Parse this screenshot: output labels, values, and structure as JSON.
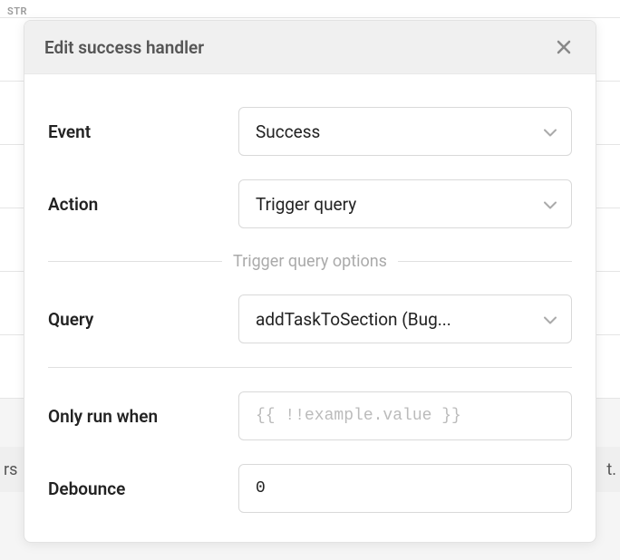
{
  "modal": {
    "title": "Edit success handler",
    "fields": {
      "event": {
        "label": "Event",
        "value": "Success"
      },
      "action": {
        "label": "Action",
        "value": "Trigger query"
      },
      "query": {
        "label": "Query",
        "value": "addTaskToSection (Bug..."
      },
      "only_run_when": {
        "label": "Only run when",
        "placeholder": "{{ !!example.value }}",
        "value": ""
      },
      "debounce": {
        "label": "Debounce",
        "value": "0"
      }
    },
    "section_label": "Trigger query options"
  },
  "background": {
    "top_label": "STR",
    "bottom_left": "rs",
    "bottom_right": "t."
  }
}
